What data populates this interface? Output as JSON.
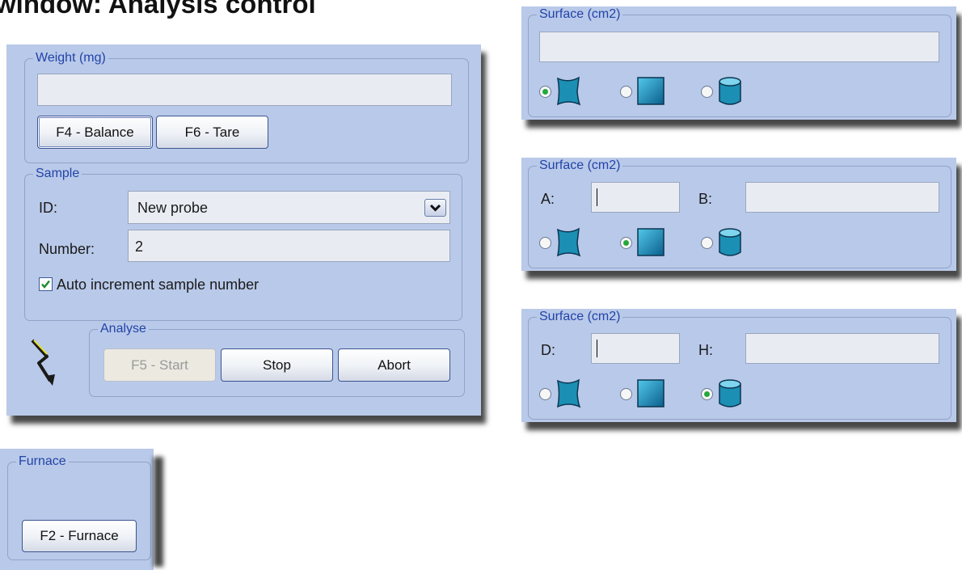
{
  "heading": "window: Analysis control",
  "main": {
    "weight": {
      "legend": "Weight (mg)",
      "value": "",
      "balance_label": "F4 - Balance",
      "tare_label": "F6 - Tare"
    },
    "sample": {
      "legend": "Sample",
      "id_label": "ID:",
      "id_value": "New probe",
      "number_label": "Number:",
      "number_value": "2",
      "auto_increment_label": "Auto increment sample number",
      "auto_increment_checked": true
    },
    "analyse": {
      "legend": "Analyse",
      "start_label": "F5 - Start",
      "stop_label": "Stop",
      "abort_label": "Abort"
    }
  },
  "furnace": {
    "legend": "Furnace",
    "button_label": "F2 - Furnace"
  },
  "surface_panels": [
    {
      "legend": "Surface (cm2)",
      "selected_shape": "irregular"
    },
    {
      "legend": "Surface (cm2)",
      "field_a_label": "A:",
      "field_b_label": "B:",
      "selected_shape": "rectangle"
    },
    {
      "legend": "Surface (cm2)",
      "field_d_label": "D:",
      "field_h_label": "H:",
      "selected_shape": "cylinder"
    }
  ],
  "icons": {
    "irregular": "irregular-shape-icon",
    "rectangle": "rectangle-shape-icon",
    "cylinder": "cylinder-shape-icon",
    "analyse": "lightning-arrow-icon"
  },
  "colors": {
    "panel_bg": "#b9c9e9",
    "legend_text": "#2244a8",
    "radio_selected": "#24a83a",
    "check_mark": "#1b8a2d"
  }
}
